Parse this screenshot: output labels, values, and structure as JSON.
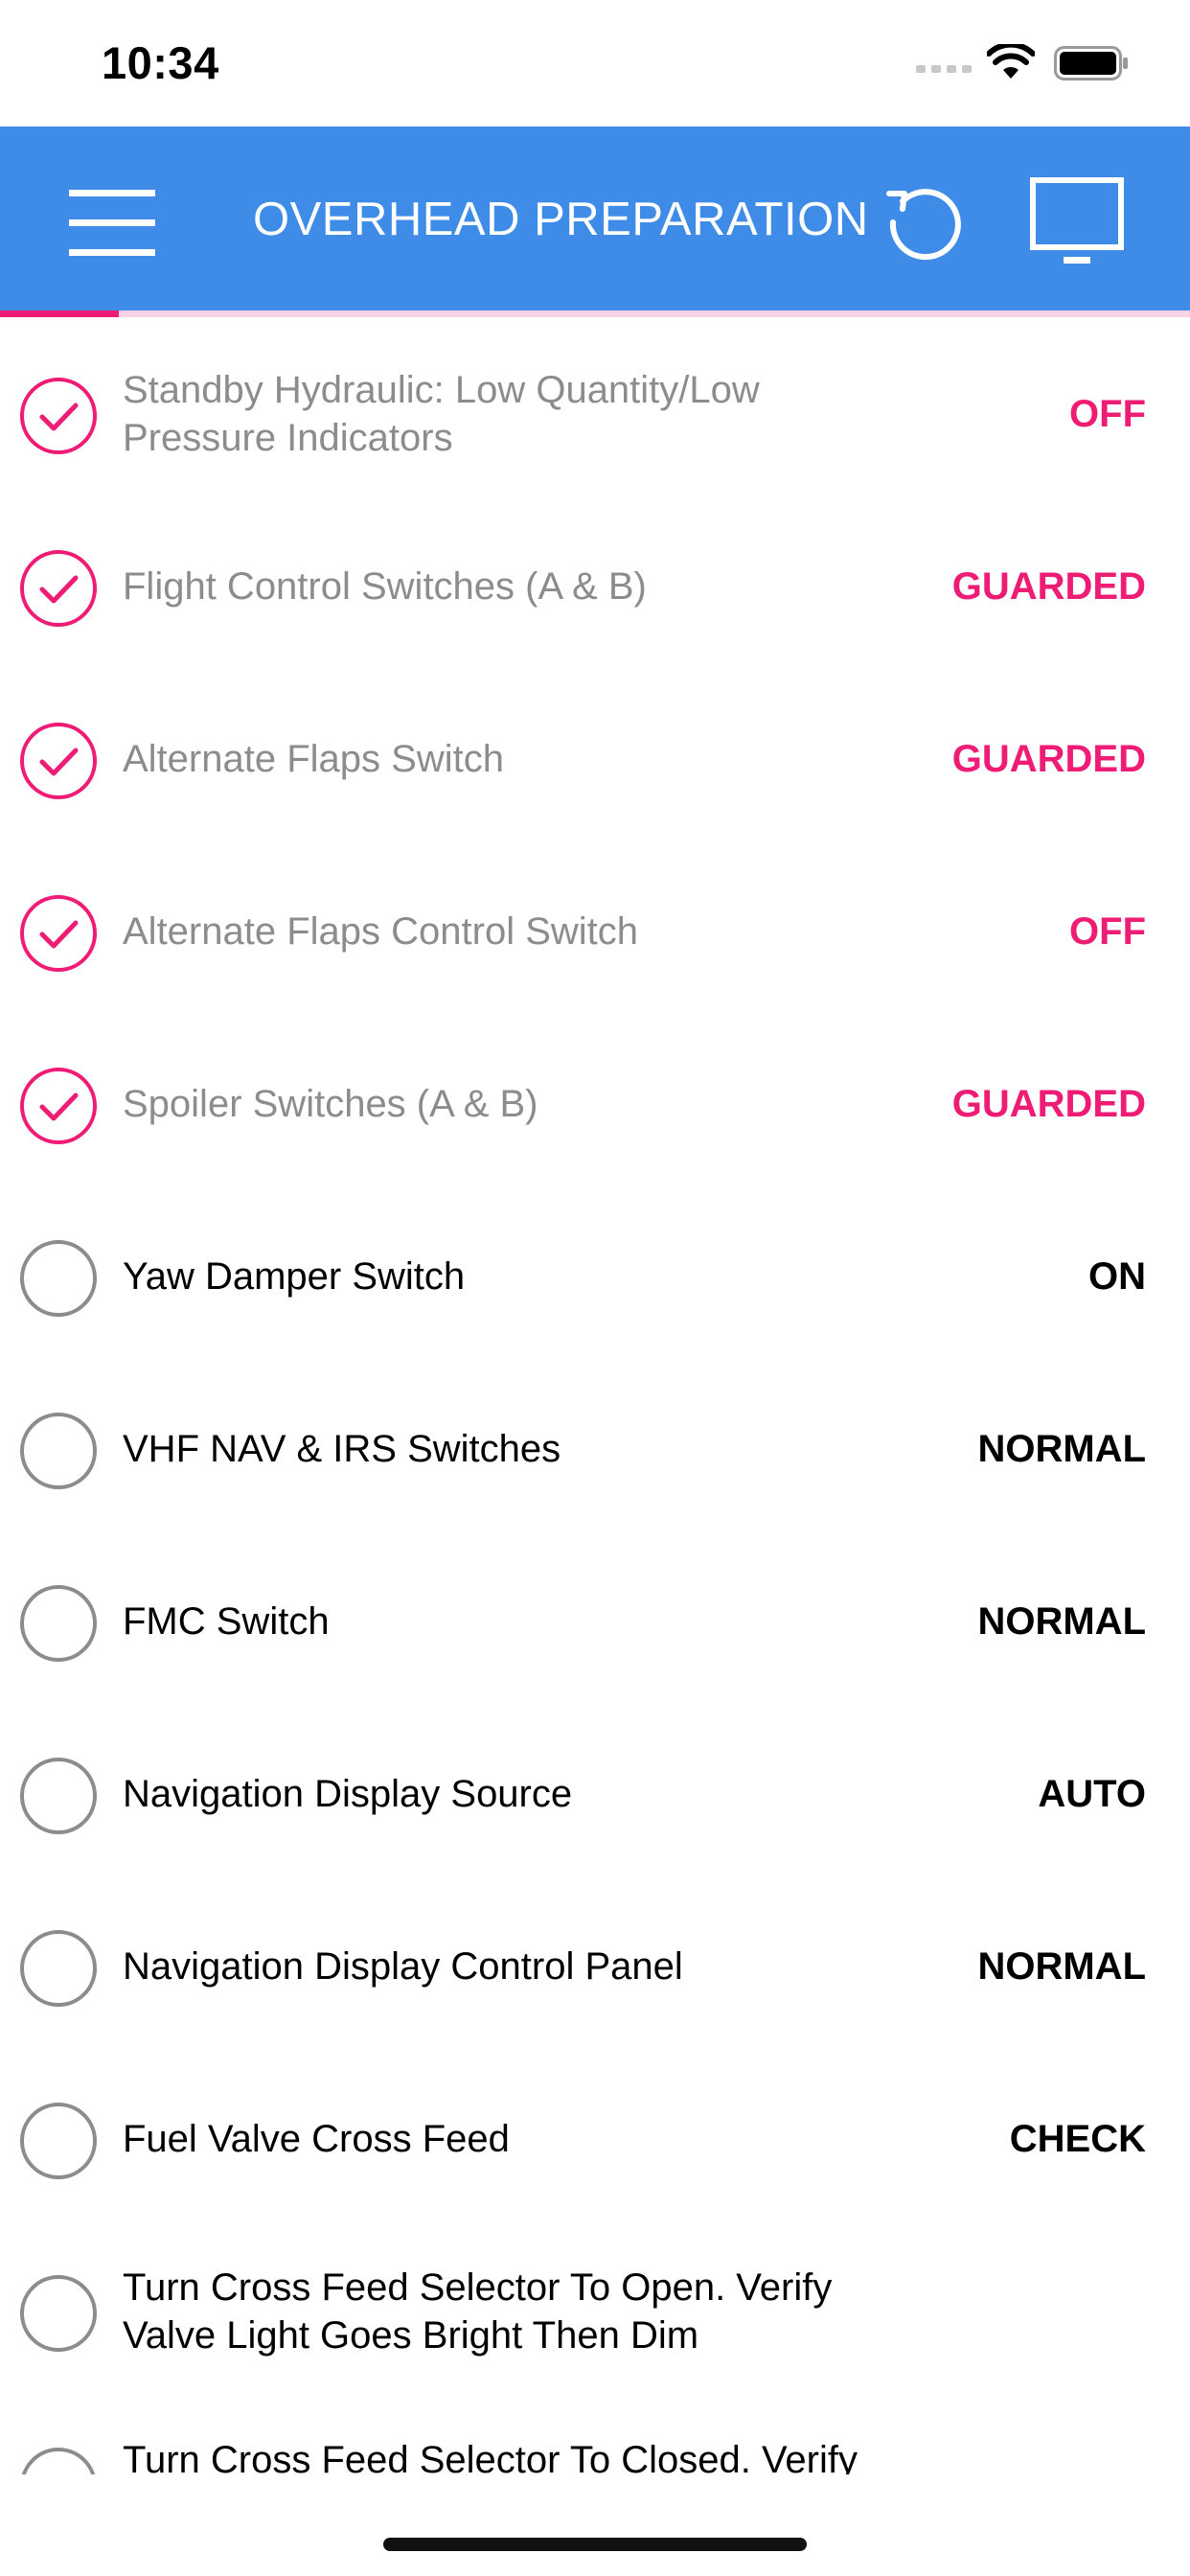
{
  "status_bar": {
    "time": "10:34"
  },
  "header": {
    "title": "OVERHEAD PREPARATION"
  },
  "progress": {
    "fraction": 0.1,
    "fill_color": "#ee1c74",
    "track_color": "#fbd3e4"
  },
  "colors": {
    "header_bg": "#3f8be8",
    "accent": "#ee1c74",
    "done_text": "#8c8c8c"
  },
  "icons": [
    "menu-icon",
    "reset-icon",
    "screen-icon",
    "check-circle-icon",
    "empty-circle-icon"
  ],
  "items": [
    {
      "label": "Standby Hydraulic: Low Quantity/Low Pressure Indicators",
      "value": "OFF",
      "done": true
    },
    {
      "label": "Flight Control Switches (A & B)",
      "value": "GUARDED",
      "done": true
    },
    {
      "label": "Alternate Flaps Switch",
      "value": "GUARDED",
      "done": true
    },
    {
      "label": "Alternate Flaps Control Switch",
      "value": "OFF",
      "done": true
    },
    {
      "label": "Spoiler Switches (A & B)",
      "value": "GUARDED",
      "done": true
    },
    {
      "label": "Yaw Damper Switch",
      "value": "ON",
      "done": false
    },
    {
      "label": "VHF NAV & IRS Switches",
      "value": "NORMAL",
      "done": false
    },
    {
      "label": "FMC Switch",
      "value": "NORMAL",
      "done": false
    },
    {
      "label": "Navigation Display Source",
      "value": "AUTO",
      "done": false
    },
    {
      "label": "Navigation Display Control Panel",
      "value": "NORMAL",
      "done": false
    },
    {
      "label": "Fuel Valve Cross Feed",
      "value": "CHECK",
      "done": false
    },
    {
      "label": "Turn Cross Feed Selector To Open. Verify Valve Light Goes Bright Then Dim",
      "value": "",
      "done": false
    },
    {
      "label": "Turn Cross Feed Selector To Closed. Verify Valve Light",
      "value": "",
      "done": false
    }
  ]
}
